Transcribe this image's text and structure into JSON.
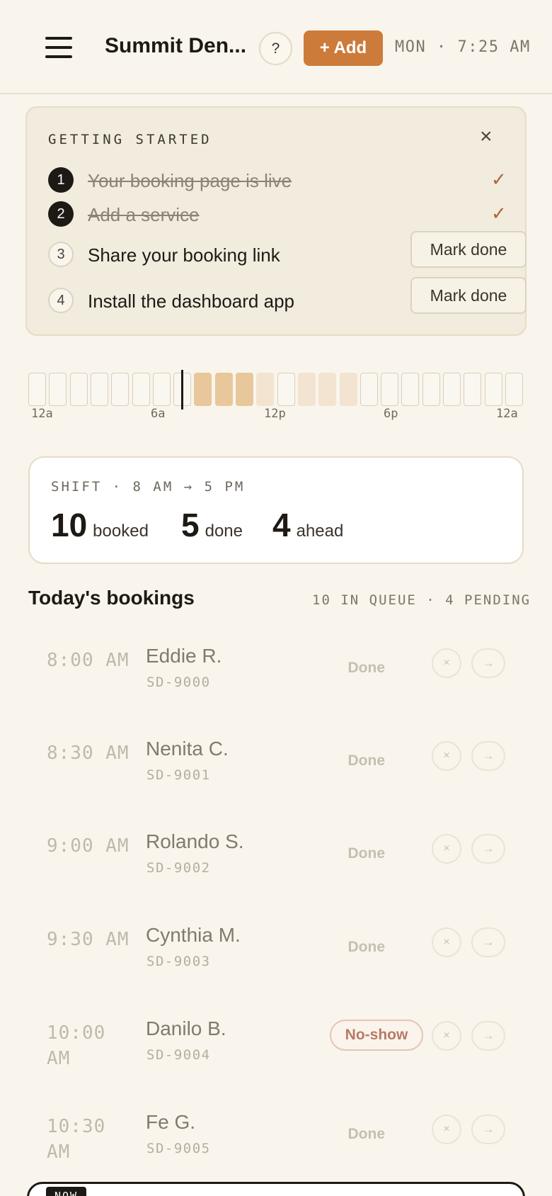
{
  "header": {
    "title": "Summit Den...",
    "help_label": "?",
    "add_label": "+ Add",
    "clock": "MON · 7:25 AM"
  },
  "getting_started": {
    "title": "GETTING STARTED",
    "close_icon": "×",
    "steps": [
      {
        "num": "1",
        "label": "Your booking page is live",
        "done": true,
        "check": "✓"
      },
      {
        "num": "2",
        "label": "Add a service",
        "done": true,
        "check": "✓"
      },
      {
        "num": "3",
        "label": "Share your booking link",
        "done": false,
        "action": "Mark done"
      },
      {
        "num": "4",
        "label": "Install the dashboard app",
        "done": false,
        "action": "Mark done"
      }
    ]
  },
  "timeline": {
    "labels": [
      "12a",
      "6a",
      "12p",
      "6p",
      "12a"
    ],
    "hour_levels": [
      0,
      0,
      0,
      0,
      0,
      0,
      0,
      0,
      2,
      2,
      2,
      1,
      0,
      1,
      1,
      1,
      0,
      0,
      0,
      0,
      0,
      0,
      0,
      0
    ],
    "current_hour_fraction": 7.42
  },
  "shift": {
    "title": "SHIFT · 8 AM → 5 PM",
    "booked_num": "10",
    "booked_label": "booked",
    "done_num": "5",
    "done_label": "done",
    "ahead_num": "4",
    "ahead_label": "ahead"
  },
  "bookings": {
    "title": "Today's bookings",
    "queue": "10 IN QUEUE · 4 PENDING",
    "rows": [
      {
        "time": "8:00 AM",
        "name": "Eddie R.",
        "id": "SD-9000",
        "status": "Done"
      },
      {
        "time": "8:30 AM",
        "name": "Nenita C.",
        "id": "SD-9001",
        "status": "Done"
      },
      {
        "time": "9:00 AM",
        "name": "Rolando S.",
        "id": "SD-9002",
        "status": "Done"
      },
      {
        "time": "9:30 AM",
        "name": "Cynthia M.",
        "id": "SD-9003",
        "status": "Done"
      },
      {
        "time": "10:00 AM",
        "name": "Danilo B.",
        "id": "SD-9004",
        "status": "No-show"
      },
      {
        "time": "10:30 AM",
        "name": "Fe G.",
        "id": "SD-9005",
        "status": "Done"
      }
    ],
    "cancel_icon": "×",
    "advance_icon": "→"
  },
  "now_card": {
    "tag": "NOW"
  },
  "colors": {
    "accent": "#cc7b3a",
    "background": "#f9f5ec",
    "ink": "#1d1a16"
  }
}
